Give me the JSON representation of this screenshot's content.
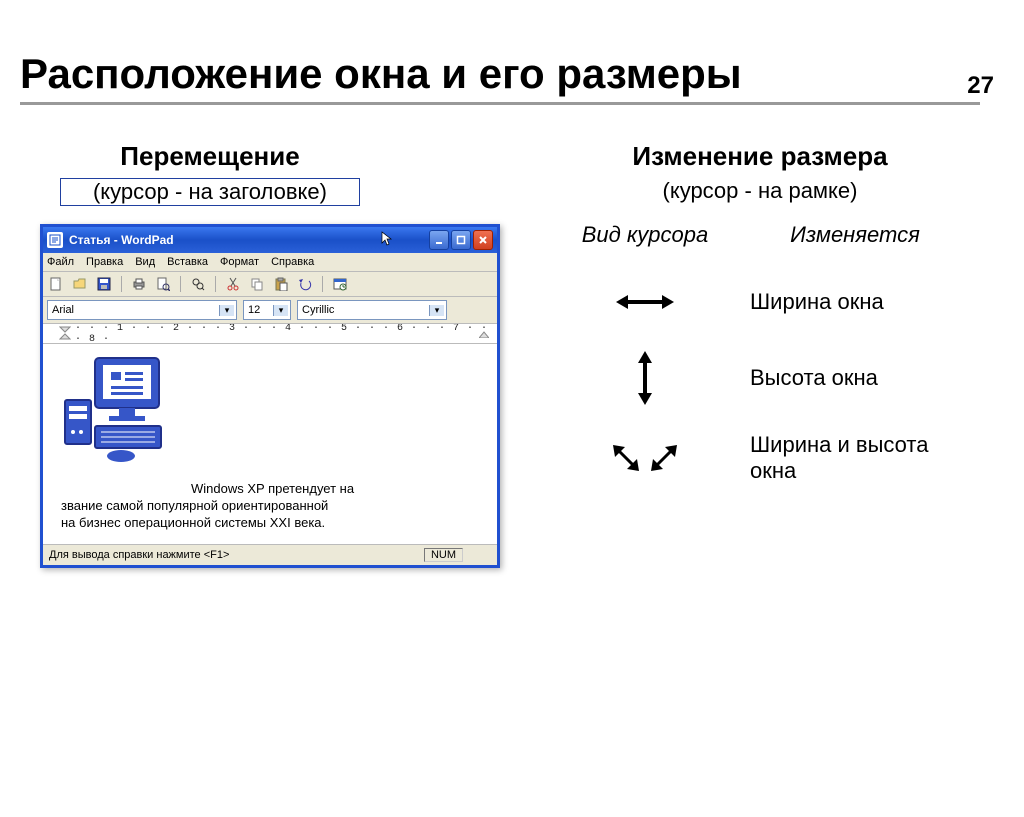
{
  "page_number": "27",
  "slide_title": "Расположение окна и его размеры",
  "left": {
    "heading": "Перемещение",
    "sub": "(курсор - на заголовке)"
  },
  "right": {
    "heading": "Изменение размера",
    "sub": "(курсор - на рамке)",
    "table": {
      "col1_header": "Вид курсора",
      "col2_header": "Изменяется",
      "rows": [
        {
          "label": "Ширина окна"
        },
        {
          "label": "Высота окна"
        },
        {
          "label": "Ширина и высота окна"
        }
      ]
    }
  },
  "wordpad": {
    "title": "Статья - WordPad",
    "menus": [
      "Файл",
      "Правка",
      "Вид",
      "Вставка",
      "Формат",
      "Справка"
    ],
    "font_name": "Arial",
    "font_size": "12",
    "script": "Cyrillic",
    "ruler": "· · · 1 · · · 2 · · · 3 · · · 4 · · · 5 · · · 6 · · · 7 · · · 8 ·",
    "doc_line1": "Windows XP претендует на",
    "doc_line2": "звание самой популярной ориентированной",
    "doc_line3": "на бизнес операционной системы XXI века.",
    "status_left": "Для вывода справки нажмите <F1>",
    "status_num": "NUM"
  }
}
